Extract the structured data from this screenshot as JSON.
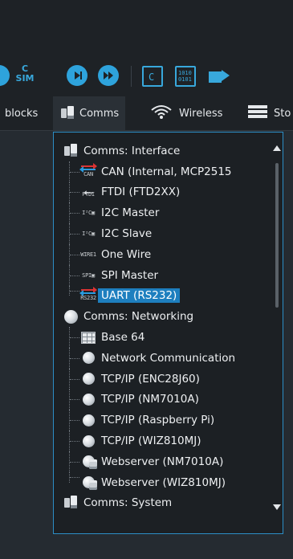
{
  "toolbar": {
    "sim_label_top": "C",
    "sim_label_bottom": "SIM",
    "bin_label": "1010\n0101"
  },
  "tabs": [
    {
      "label": "blocks"
    },
    {
      "label": "Comms"
    },
    {
      "label": "Wireless"
    },
    {
      "label": "Sto"
    }
  ],
  "tree": {
    "categories": [
      {
        "label": "Comms: Interface",
        "items": [
          {
            "label": "CAN (Internal, MCP2515",
            "tag": "CAN"
          },
          {
            "label": "FTDI (FTD2XX)",
            "tag": "FTDI"
          },
          {
            "label": "I2C Master",
            "tag": "I²C▣"
          },
          {
            "label": "I2C Slave",
            "tag": "I²C▣"
          },
          {
            "label": "One Wire",
            "tag": "WIRE1"
          },
          {
            "label": "SPI Master",
            "tag": "SPI▣"
          },
          {
            "label": "UART (RS232)",
            "tag": "RS232",
            "selected": true
          }
        ]
      },
      {
        "label": "Comms: Networking",
        "items": [
          {
            "label": "Base 64"
          },
          {
            "label": "Network Communication"
          },
          {
            "label": "TCP/IP (ENC28J60)"
          },
          {
            "label": "TCP/IP (NM7010A)"
          },
          {
            "label": "TCP/IP (Raspberry Pi)"
          },
          {
            "label": "TCP/IP (WIZ810MJ)"
          },
          {
            "label": "Webserver (NM7010A)"
          },
          {
            "label": "Webserver (WIZ810MJ)"
          }
        ]
      },
      {
        "label": "Comms: System",
        "items": []
      }
    ]
  },
  "colors": {
    "accent": "#2c8ec6",
    "selected_bg": "#1e7fbf",
    "background": "#252b31"
  }
}
